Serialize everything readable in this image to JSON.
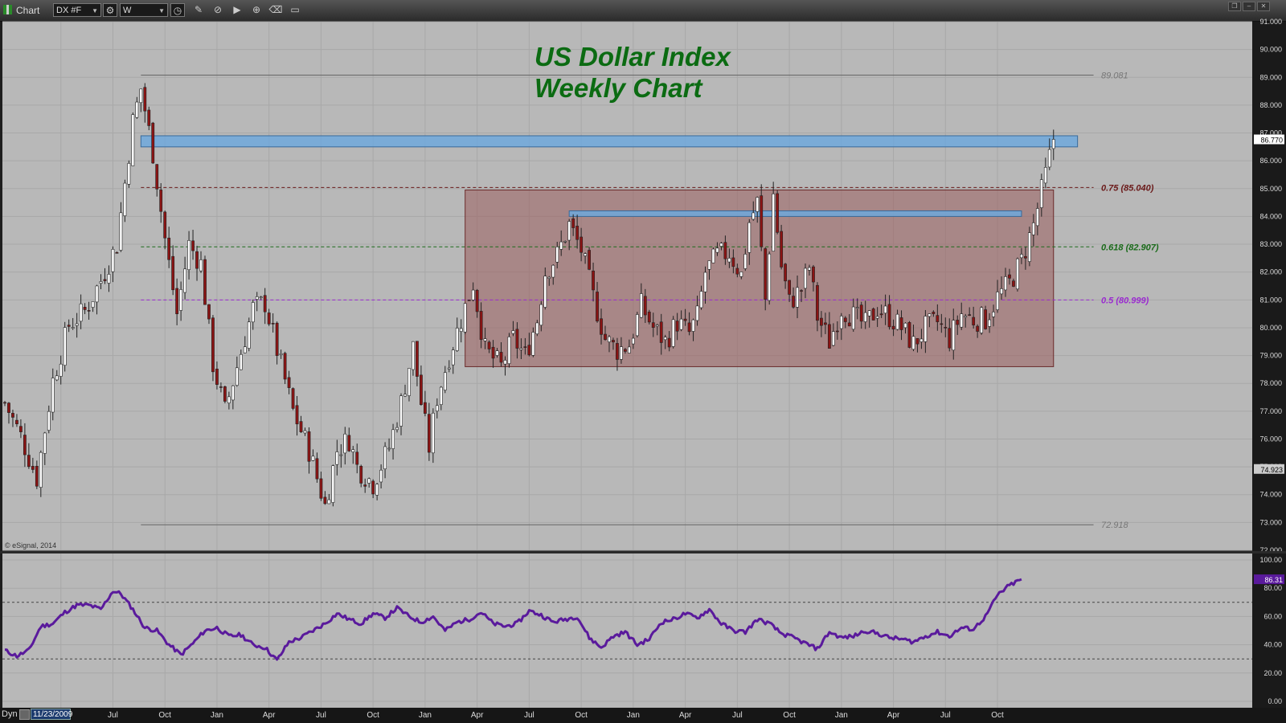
{
  "window": {
    "title": "Chart",
    "symbol": "DX #F",
    "interval": "W",
    "copyright": "© eSignal, 2014"
  },
  "status_bar": {
    "mode": "Dyn",
    "cursor_date": "11/23/2009"
  },
  "colors": {
    "panel_bg": "#b8b8b8",
    "candle_up": "#ffffff",
    "candle_down": "#8b1414",
    "resistance_band": "#6fa8dc",
    "range_box": "#9b5f5f",
    "rsi_line": "#5a1a9c",
    "title": "#0b6b12",
    "fib_075": "#6b1a1a",
    "fib_0618": "#1a6b1a",
    "fib_05": "#9a2ad0"
  },
  "icons": [
    "settings-icon",
    "clock-icon",
    "pencil-icon",
    "cursor-icon",
    "play-icon",
    "zoom-icon",
    "eraser-icon",
    "comment-icon"
  ],
  "chart_data": [
    {
      "type": "candlestick",
      "title": "US Dollar Index\nWeekly Chart",
      "title_lines": [
        "US Dollar Index",
        "Weekly Chart"
      ],
      "x_tick_labels": [
        "Apr",
        "Jul",
        "Oct",
        "Jan",
        "Apr",
        "Jul",
        "Oct",
        "Jan",
        "Apr",
        "Jul",
        "Oct",
        "Jan",
        "Apr",
        "Jul",
        "Oct",
        "Jan",
        "Apr",
        "Jul",
        "Oct"
      ],
      "x_tick_weeks": [
        14,
        27,
        40,
        53,
        66,
        79,
        92,
        105,
        118,
        131,
        144,
        157,
        170,
        183,
        196,
        209,
        222,
        235,
        248
      ],
      "ylim": [
        72,
        91
      ],
      "y_tick_labels": [
        "72.000",
        "73.000",
        "74.000",
        "75.000",
        "76.000",
        "77.000",
        "78.000",
        "79.000",
        "80.000",
        "81.000",
        "82.000",
        "83.000",
        "84.000",
        "85.000",
        "86.000",
        "87.000",
        "88.000",
        "89.000",
        "90.000",
        "91.000"
      ],
      "price_tags": {
        "last": "86.770",
        "marker": "74.923"
      },
      "grid": true,
      "levels": [
        {
          "label": "89.081",
          "value": 89.081,
          "style": "solid",
          "color": "#666666"
        },
        {
          "label": "72.918",
          "value": 72.918,
          "style": "solid",
          "color": "#666666"
        },
        {
          "label": "0.75 (85.040)",
          "value": 85.04,
          "style": "dashed",
          "color": "#6b1a1a"
        },
        {
          "label": "0.618 (82.907)",
          "value": 82.907,
          "style": "dashed",
          "color": "#1a6b1a"
        },
        {
          "label": "0.5 (80.999)",
          "value": 80.999,
          "style": "dashed",
          "color": "#9a2ad0"
        }
      ],
      "zones": [
        {
          "kind": "resistance-band",
          "x_weeks": [
            34,
            268
          ],
          "y_range": [
            86.5,
            86.9
          ]
        },
        {
          "kind": "range-box",
          "x_weeks": [
            115,
            262
          ],
          "y_range": [
            78.6,
            84.95
          ]
        },
        {
          "kind": "resistance-band",
          "x_weeks": [
            141,
            254
          ],
          "y_range": [
            84.0,
            84.2
          ]
        }
      ],
      "price_path": {
        "start_week": 0,
        "anchors": [
          [
            0,
            77.3
          ],
          [
            4,
            76.1
          ],
          [
            8,
            74.6
          ],
          [
            12,
            78.1
          ],
          [
            16,
            80.1
          ],
          [
            20,
            80.6
          ],
          [
            24,
            81.7
          ],
          [
            28,
            83.0
          ],
          [
            32,
            87.4
          ],
          [
            34,
            88.6
          ],
          [
            37,
            86.3
          ],
          [
            40,
            83.2
          ],
          [
            43,
            80.5
          ],
          [
            46,
            83.0
          ],
          [
            49,
            82.3
          ],
          [
            52,
            78.7
          ],
          [
            55,
            77.0
          ],
          [
            58,
            78.6
          ],
          [
            62,
            80.7
          ],
          [
            65,
            80.9
          ],
          [
            68,
            79.2
          ],
          [
            72,
            77.0
          ],
          [
            76,
            75.6
          ],
          [
            80,
            73.6
          ],
          [
            83,
            75.6
          ],
          [
            86,
            76.0
          ],
          [
            88,
            75.0
          ],
          [
            92,
            74.4
          ],
          [
            96,
            75.7
          ],
          [
            99,
            77.3
          ],
          [
            102,
            79.3
          ],
          [
            104,
            77.3
          ],
          [
            106,
            75.7
          ],
          [
            108,
            77.5
          ],
          [
            111,
            79.0
          ],
          [
            114,
            80.3
          ],
          [
            117,
            81.6
          ],
          [
            120,
            79.2
          ],
          [
            124,
            78.6
          ],
          [
            127,
            79.6
          ],
          [
            130,
            79.0
          ],
          [
            133,
            80.3
          ],
          [
            135,
            82.0
          ],
          [
            138,
            82.6
          ],
          [
            141,
            83.7
          ],
          [
            144,
            82.8
          ],
          [
            147,
            81.1
          ],
          [
            150,
            79.6
          ],
          [
            153,
            79.2
          ],
          [
            156,
            79.4
          ],
          [
            159,
            80.8
          ],
          [
            162,
            80.0
          ],
          [
            165,
            79.5
          ],
          [
            168,
            80.2
          ],
          [
            171,
            79.8
          ],
          [
            173,
            80.4
          ],
          [
            175,
            82.0
          ],
          [
            178,
            82.6
          ],
          [
            181,
            82.7
          ],
          [
            184,
            81.9
          ],
          [
            186,
            83.8
          ],
          [
            188,
            84.5
          ],
          [
            190,
            81.0
          ],
          [
            192,
            84.8
          ],
          [
            194,
            82.2
          ],
          [
            196,
            80.9
          ],
          [
            199,
            81.4
          ],
          [
            201,
            82.2
          ],
          [
            203,
            80.4
          ],
          [
            206,
            79.5
          ],
          [
            209,
            80.7
          ],
          [
            212,
            80.4
          ],
          [
            215,
            80.1
          ],
          [
            218,
            80.7
          ],
          [
            221,
            80.4
          ],
          [
            224,
            80.0
          ],
          [
            227,
            79.4
          ],
          [
            230,
            80.0
          ],
          [
            233,
            80.2
          ],
          [
            236,
            79.6
          ],
          [
            239,
            80.5
          ],
          [
            242,
            80.3
          ],
          [
            245,
            80.3
          ],
          [
            248,
            81.1
          ],
          [
            251,
            81.6
          ],
          [
            254,
            82.4
          ],
          [
            257,
            83.7
          ],
          [
            260,
            85.5
          ],
          [
            262,
            86.77
          ]
        ]
      },
      "last_price": 86.77
    },
    {
      "type": "line",
      "indicator": "RSI",
      "ylim": [
        0,
        100
      ],
      "y_tick_labels": [
        "0.00",
        "20.00",
        "40.00",
        "60.00",
        "80.00",
        "100.00"
      ],
      "reference_levels": [
        70,
        30
      ],
      "last_value_label": "86.31",
      "last_value": 86.31,
      "series": [
        {
          "anchors": [
            [
              0,
              36
            ],
            [
              3,
              32
            ],
            [
              6,
              36
            ],
            [
              9,
              53
            ],
            [
              12,
              55
            ],
            [
              15,
              63
            ],
            [
              18,
              68
            ],
            [
              21,
              68
            ],
            [
              24,
              65
            ],
            [
              27,
              78
            ],
            [
              29,
              76
            ],
            [
              32,
              65
            ],
            [
              35,
              52
            ],
            [
              38,
              50
            ],
            [
              41,
              40
            ],
            [
              44,
              33
            ],
            [
              47,
              41
            ],
            [
              50,
              50
            ],
            [
              53,
              52
            ],
            [
              56,
              46
            ],
            [
              59,
              47
            ],
            [
              62,
              40
            ],
            [
              65,
              38
            ],
            [
              68,
              29
            ],
            [
              71,
              42
            ],
            [
              74,
              45
            ],
            [
              77,
              50
            ],
            [
              80,
              55
            ],
            [
              83,
              62
            ],
            [
              86,
              58
            ],
            [
              89,
              55
            ],
            [
              92,
              62
            ],
            [
              95,
              59
            ],
            [
              98,
              66
            ],
            [
              101,
              60
            ],
            [
              104,
              56
            ],
            [
              107,
              60
            ],
            [
              110,
              50
            ],
            [
              113,
              56
            ],
            [
              116,
              58
            ],
            [
              119,
              63
            ],
            [
              122,
              55
            ],
            [
              125,
              53
            ],
            [
              128,
              55
            ],
            [
              131,
              64
            ],
            [
              134,
              61
            ],
            [
              137,
              56
            ],
            [
              140,
              58
            ],
            [
              143,
              60
            ],
            [
              146,
              45
            ],
            [
              149,
              38
            ],
            [
              152,
              46
            ],
            [
              155,
              49
            ],
            [
              158,
              40
            ],
            [
              161,
              44
            ],
            [
              164,
              56
            ],
            [
              167,
              58
            ],
            [
              170,
              62
            ],
            [
              173,
              59
            ],
            [
              176,
              65
            ],
            [
              179,
              55
            ],
            [
              182,
              50
            ],
            [
              185,
              49
            ],
            [
              188,
              58
            ],
            [
              191,
              55
            ],
            [
              194,
              48
            ],
            [
              197,
              45
            ],
            [
              200,
              41
            ],
            [
              203,
              37
            ],
            [
              206,
              49
            ],
            [
              209,
              45
            ],
            [
              212,
              46
            ],
            [
              215,
              50
            ],
            [
              218,
              48
            ],
            [
              221,
              45
            ],
            [
              224,
              44
            ],
            [
              227,
              42
            ],
            [
              230,
              46
            ],
            [
              233,
              49
            ],
            [
              236,
              46
            ],
            [
              239,
              52
            ],
            [
              242,
              51
            ],
            [
              245,
              60
            ],
            [
              248,
              75
            ],
            [
              251,
              82
            ],
            [
              254,
              86.31
            ]
          ]
        }
      ]
    }
  ]
}
